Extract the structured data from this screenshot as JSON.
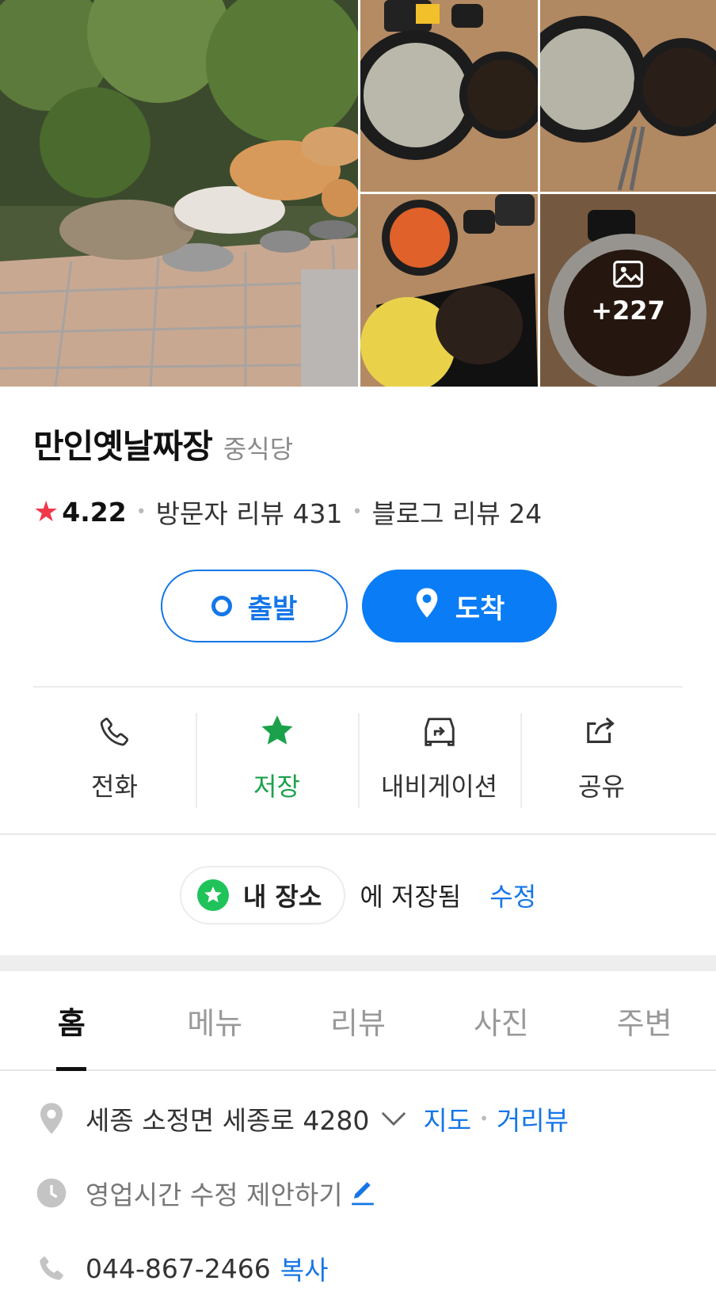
{
  "gallery": {
    "more_count": "+227"
  },
  "place": {
    "name": "만인옛날짜장",
    "category": "중식당",
    "rating": "4.22",
    "visitor_reviews": "방문자 리뷰 431",
    "blog_reviews": "블로그 리뷰 24"
  },
  "route": {
    "start_label": "출발",
    "end_label": "도착"
  },
  "actions": [
    {
      "label": "전화",
      "icon": "phone-icon"
    },
    {
      "label": "저장",
      "icon": "star-icon"
    },
    {
      "label": "내비게이션",
      "icon": "navigation-car-icon"
    },
    {
      "label": "공유",
      "icon": "share-icon"
    }
  ],
  "saved": {
    "list_name": "내 장소",
    "text": "에 저장됨",
    "edit_label": "수정"
  },
  "tabs": [
    "홈",
    "메뉴",
    "리뷰",
    "사진",
    "주변"
  ],
  "info": {
    "address": "세종 소정면 세종로 4280",
    "map_link": "지도",
    "roadview_link": "거리뷰",
    "hours_suggest": "영업시간 수정 제안하기",
    "phone": "044-867-2466",
    "copy_label": "복사"
  },
  "colors": {
    "accent": "#0a7cf5",
    "saved_green": "#1ba14b",
    "rating_star": "#f0384b"
  }
}
